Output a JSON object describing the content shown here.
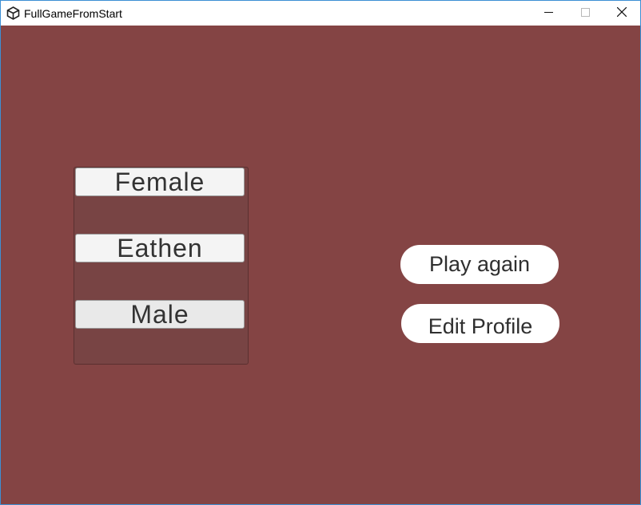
{
  "window": {
    "title": "FullGameFromStart",
    "icon": "unity-logo-icon",
    "controls": {
      "minimize_icon": "minimize-icon",
      "maximize_icon": "maximize-icon",
      "close_icon": "close-icon"
    }
  },
  "colors": {
    "background": "#844444",
    "panel": "#784444",
    "list_button": "#f4f4f4",
    "pill_button": "#ffffff",
    "button_text": "#333333"
  },
  "character_list": {
    "items": [
      {
        "label": "Female"
      },
      {
        "label": "Eathen"
      },
      {
        "label": "Male"
      }
    ]
  },
  "actions": {
    "play_again_label": "Play again",
    "edit_profile_label": "Edit Profile"
  }
}
